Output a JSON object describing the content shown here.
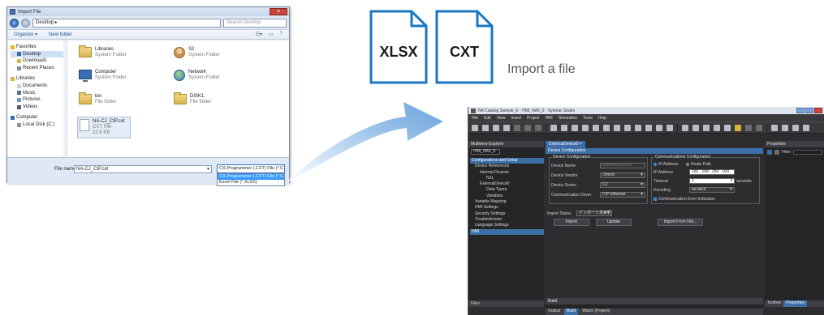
{
  "import_dialog": {
    "title": "Import File",
    "breadcrumb": "Desktop",
    "search_placeholder": "Search Desktop",
    "toolbar": {
      "organize": "Organize ▾",
      "new_folder": "New folder"
    },
    "nav": [
      {
        "label": "Favorites",
        "group": true
      },
      {
        "label": "Desktop",
        "selected": true
      },
      {
        "label": "Downloads"
      },
      {
        "label": "Recent Places"
      },
      {
        "label": "Libraries",
        "group": true
      },
      {
        "label": "Documents"
      },
      {
        "label": "Music"
      },
      {
        "label": "Pictures"
      },
      {
        "label": "Videos"
      },
      {
        "label": "Computer",
        "group": true
      },
      {
        "label": "Local Disk (C:)"
      }
    ],
    "files": [
      {
        "name": "Libraries",
        "type": "System Folder",
        "icon": "folder"
      },
      {
        "name": "S2",
        "type": "System Folder",
        "icon": "user"
      },
      {
        "name": "Computer",
        "type": "System Folder",
        "icon": "monitor"
      },
      {
        "name": "Network",
        "type": "System Folder",
        "icon": "globe"
      },
      {
        "name": "bin",
        "type": "File folder",
        "icon": "folder"
      },
      {
        "name": "DISK1",
        "type": "File folder",
        "icon": "folder"
      },
      {
        "name": "NA-CJ_CIP.cxt",
        "type": "CXT File",
        "size": "22.6 KB",
        "icon": "document"
      }
    ],
    "file_name_label": "File name:",
    "file_name_value": "NA-CJ_CIP.cxt",
    "file_type_selected": "CX-Programmer (.CXT) File (*.C",
    "file_type_options": [
      "CX-Programmer (.CXT) File (*.CXT)",
      "Excel File (*.XLSX)"
    ]
  },
  "file_icons": [
    {
      "label": "XLSX"
    },
    {
      "label": "CXT"
    }
  ],
  "caption": "Import a file",
  "sysmac": {
    "title": "NA Catalog Sample_E - HMI_NA5_0 - Sysmac Studio",
    "menu": [
      "File",
      "Edit",
      "View",
      "Insert",
      "Project",
      "HMI",
      "Simulation",
      "Tools",
      "Help"
    ],
    "explorer_title": "Multiview Explorer",
    "device_combo": "HMI_NA5_0",
    "tree": [
      {
        "label": "Configurations and Setup",
        "header": true
      },
      {
        "label": "Device References"
      },
      {
        "label": "Internal Devices"
      },
      {
        "label": "NJ1"
      },
      {
        "label": "ExternalDevice0"
      },
      {
        "label": "Data Types"
      },
      {
        "label": "Variables"
      },
      {
        "label": "Variable Mapping"
      },
      {
        "label": "HMI Settings"
      },
      {
        "label": "Security Settings"
      },
      {
        "label": "Troubleshooter"
      },
      {
        "label": "Language Settings"
      },
      {
        "label": "HMI",
        "header": true
      }
    ],
    "doc_tab": "ExternalDevice0",
    "section": "Device Configuration",
    "device_group": {
      "title": "Device Configuration",
      "name_label": "Device Name",
      "name_value": "ExternalDevice0",
      "vendor_label": "Device Vendor",
      "vendor_value": "Omron",
      "series_label": "Device Series",
      "series_value": "CJ",
      "driver_label": "Communication Driver",
      "driver_value": "CIP Ethernet"
    },
    "comm_group": {
      "title": "Communications Configuration",
      "ip_option": "IP Address",
      "route_option": "Route Path",
      "ip_label": "IP Address",
      "ip_value": "192 . 168 . 250 . 100",
      "timeout_label": "Timeout",
      "timeout_value": "2",
      "timeout_unit": "seconds",
      "encoding_label": "Encoding",
      "encoding_value": "us-ascii",
      "error_indication": "Communication Error Indication"
    },
    "import_status_label": "Import Status",
    "import_status_value": "インポート未実行",
    "buttons": {
      "import": "Import",
      "update": "Update",
      "import_from_file": "Import From File..."
    },
    "properties_title": "Properties",
    "filter_label": "Filter",
    "build_title": "Build",
    "bottom_tabs": [
      "Output",
      "Build",
      "Watch (Project)"
    ],
    "left_filter": "Filter",
    "right_tabs": [
      "Toolbox",
      "Properties"
    ]
  }
}
